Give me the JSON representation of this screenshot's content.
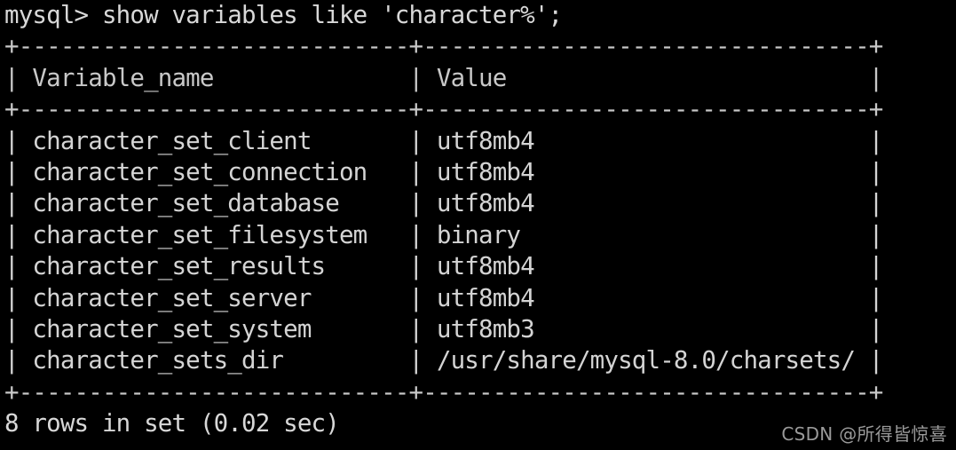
{
  "terminal": {
    "background_color": "#000000",
    "text_color": "#d4d4d4",
    "prompt_line": "mysql> show variables like 'character%';",
    "separator_top": "+----------------------------+--------------------------------+",
    "header_line": "| Variable_name              | Value                          |",
    "separator_mid": "+----------------------------+--------------------------------+",
    "separator_bottom": "+----------------------------+--------------------------------+",
    "footer_line": "8 rows in set (0.02 sec)",
    "prompt": "mysql>",
    "command": "show variables like 'character%';",
    "columns": [
      "Variable_name",
      "Value"
    ],
    "rows": [
      {
        "variable_name": "character_set_client",
        "value": "utf8mb4"
      },
      {
        "variable_name": "character_set_connection",
        "value": "utf8mb4"
      },
      {
        "variable_name": "character_set_database",
        "value": "utf8mb4"
      },
      {
        "variable_name": "character_set_filesystem",
        "value": "binary"
      },
      {
        "variable_name": "character_set_results",
        "value": "utf8mb4"
      },
      {
        "variable_name": "character_set_server",
        "value": "utf8mb4"
      },
      {
        "variable_name": "character_set_system",
        "value": "utf8mb3"
      },
      {
        "variable_name": "character_sets_dir",
        "value": "/usr/share/mysql-8.0/charsets/"
      }
    ],
    "row_lines": [
      "| character_set_client       | utf8mb4                        |",
      "| character_set_connection   | utf8mb4                        |",
      "| character_set_database     | utf8mb4                        |",
      "| character_set_filesystem   | binary                         |",
      "| character_set_results      | utf8mb4                        |",
      "| character_set_server       | utf8mb4                        |",
      "| character_set_system       | utf8mb3                        |",
      "| character_sets_dir         | /usr/share/mysql-8.0/charsets/ |"
    ],
    "row_count": "8",
    "elapsed": "0.02 sec"
  },
  "watermark": {
    "text": "CSDN @所得皆惊喜",
    "color": "#9a9a9a"
  }
}
